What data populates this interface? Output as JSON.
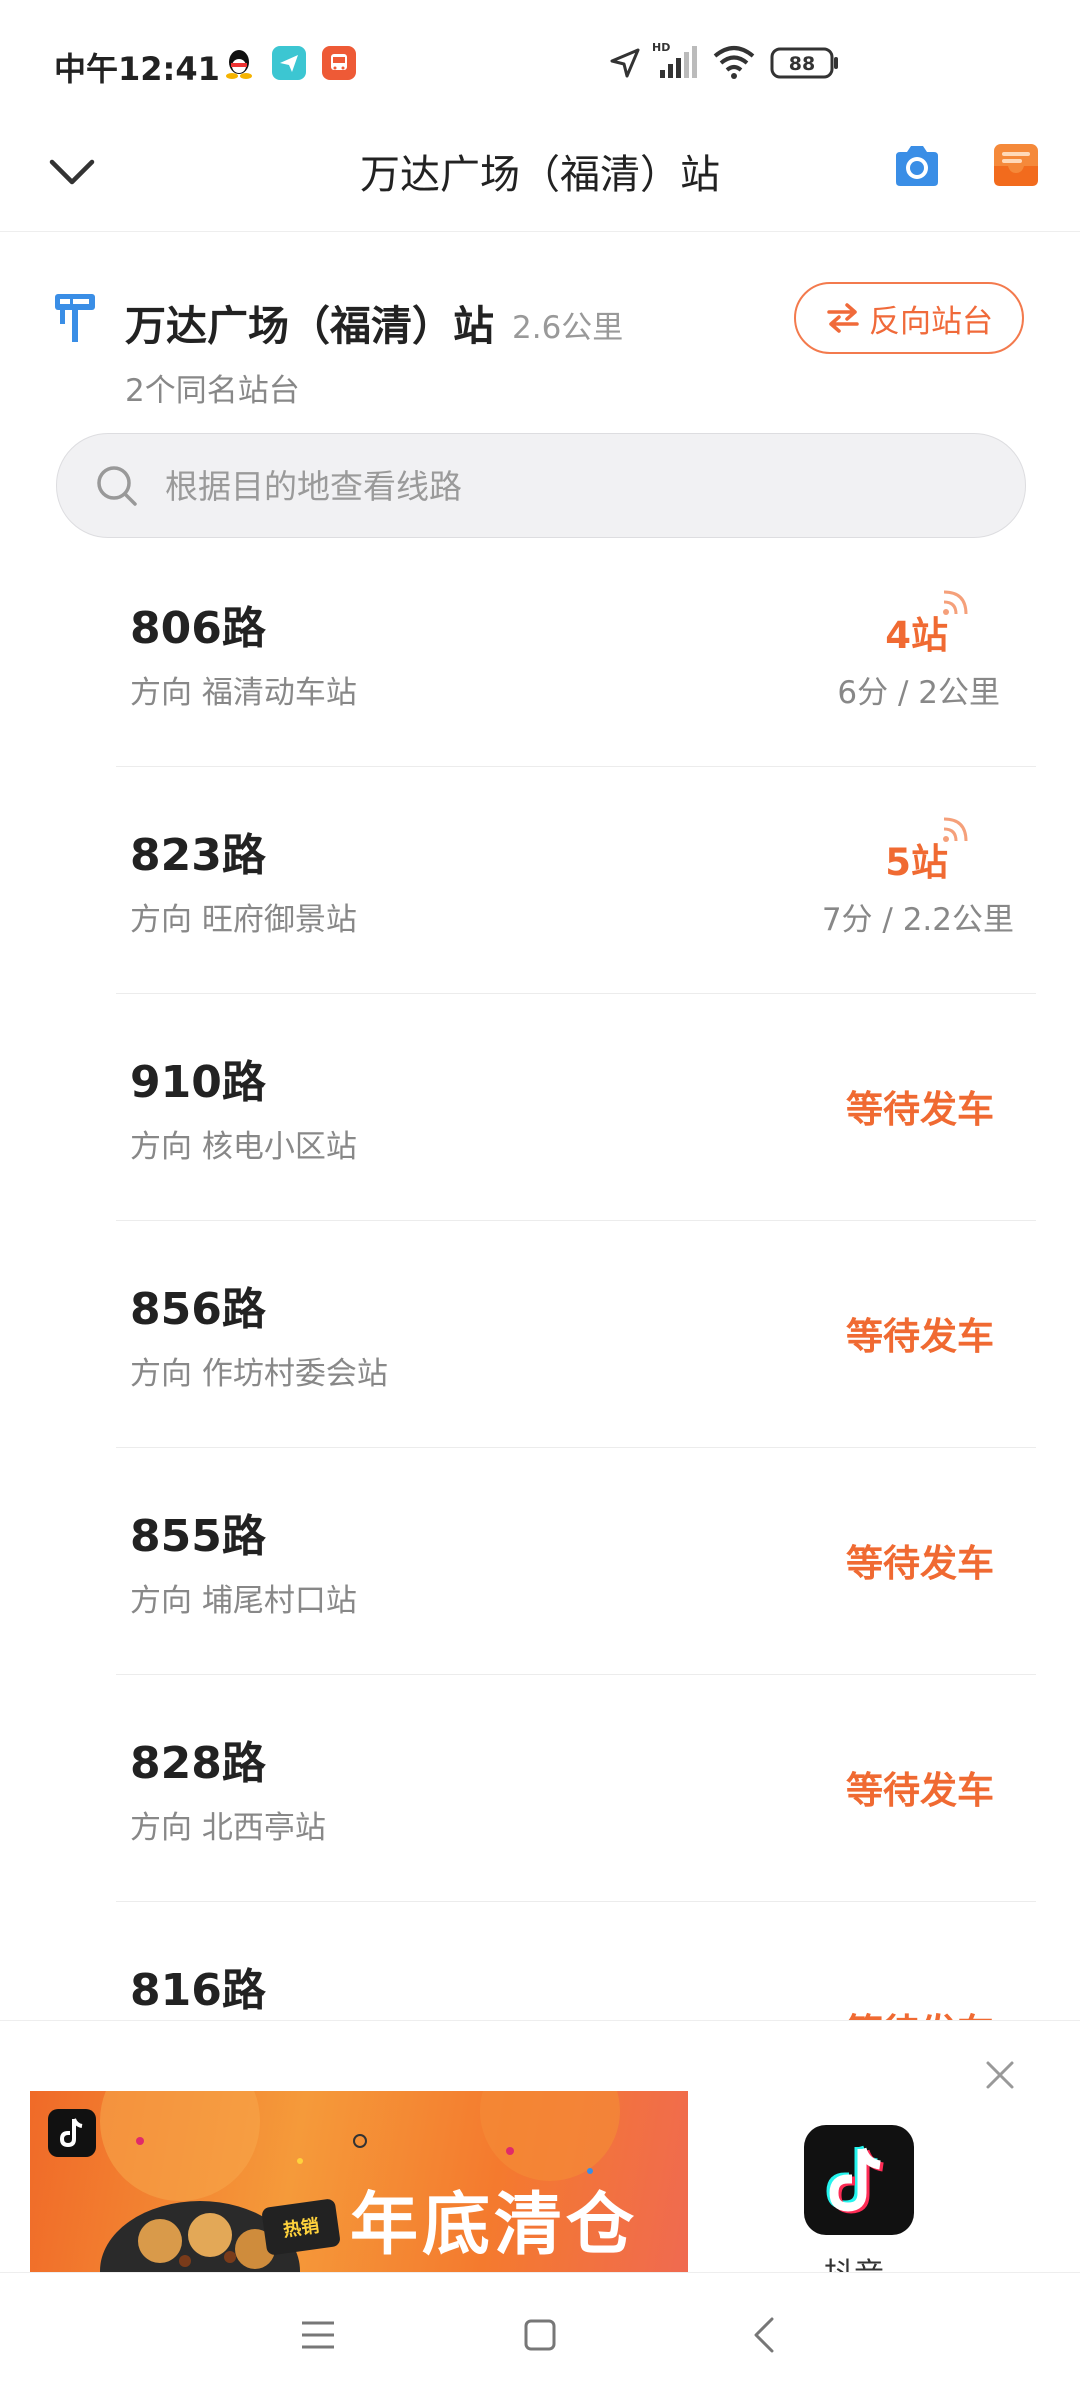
{
  "status_bar": {
    "time": "中午12:41",
    "network": "HD",
    "battery": "88"
  },
  "header": {
    "title": "万达广场（福清）站",
    "back_icon": "chevron-down-icon",
    "camera_icon": "camera-icon",
    "mail_icon": "mailbox-icon"
  },
  "station": {
    "name": "万达广场（福清）站",
    "distance": "2.6公里",
    "subtitle": "2个同名站台",
    "reverse_label": "反向站台"
  },
  "search": {
    "placeholder": "根据目的地查看线路"
  },
  "routes": [
    {
      "name": "806路",
      "direction": "方向 福清动车站",
      "stops": "4站",
      "eta": "6分 / 2公里",
      "status": ""
    },
    {
      "name": "823路",
      "direction": "方向 旺府御景站",
      "stops": "5站",
      "eta": "7分 / 2.2公里",
      "status": ""
    },
    {
      "name": "910路",
      "direction": "方向 核电小区站",
      "stops": "",
      "eta": "",
      "status": "等待发车"
    },
    {
      "name": "856路",
      "direction": "方向 作坊村委会站",
      "stops": "",
      "eta": "",
      "status": "等待发车"
    },
    {
      "name": "855路",
      "direction": "方向 埔尾村口站",
      "stops": "",
      "eta": "",
      "status": "等待发车"
    },
    {
      "name": "828路",
      "direction": "方向 北西亭站",
      "stops": "",
      "eta": "",
      "status": "等待发车"
    },
    {
      "name": "816路",
      "direction": "",
      "stops": "",
      "eta": "",
      "status": "等待发车"
    }
  ],
  "ad": {
    "banner_text": "年底清仓",
    "tag_text": "热销",
    "app_name": "抖音"
  },
  "colors": {
    "accent": "#f06a32",
    "camera_blue": "#3a8ee6",
    "mail_orange": "#f5893a"
  }
}
